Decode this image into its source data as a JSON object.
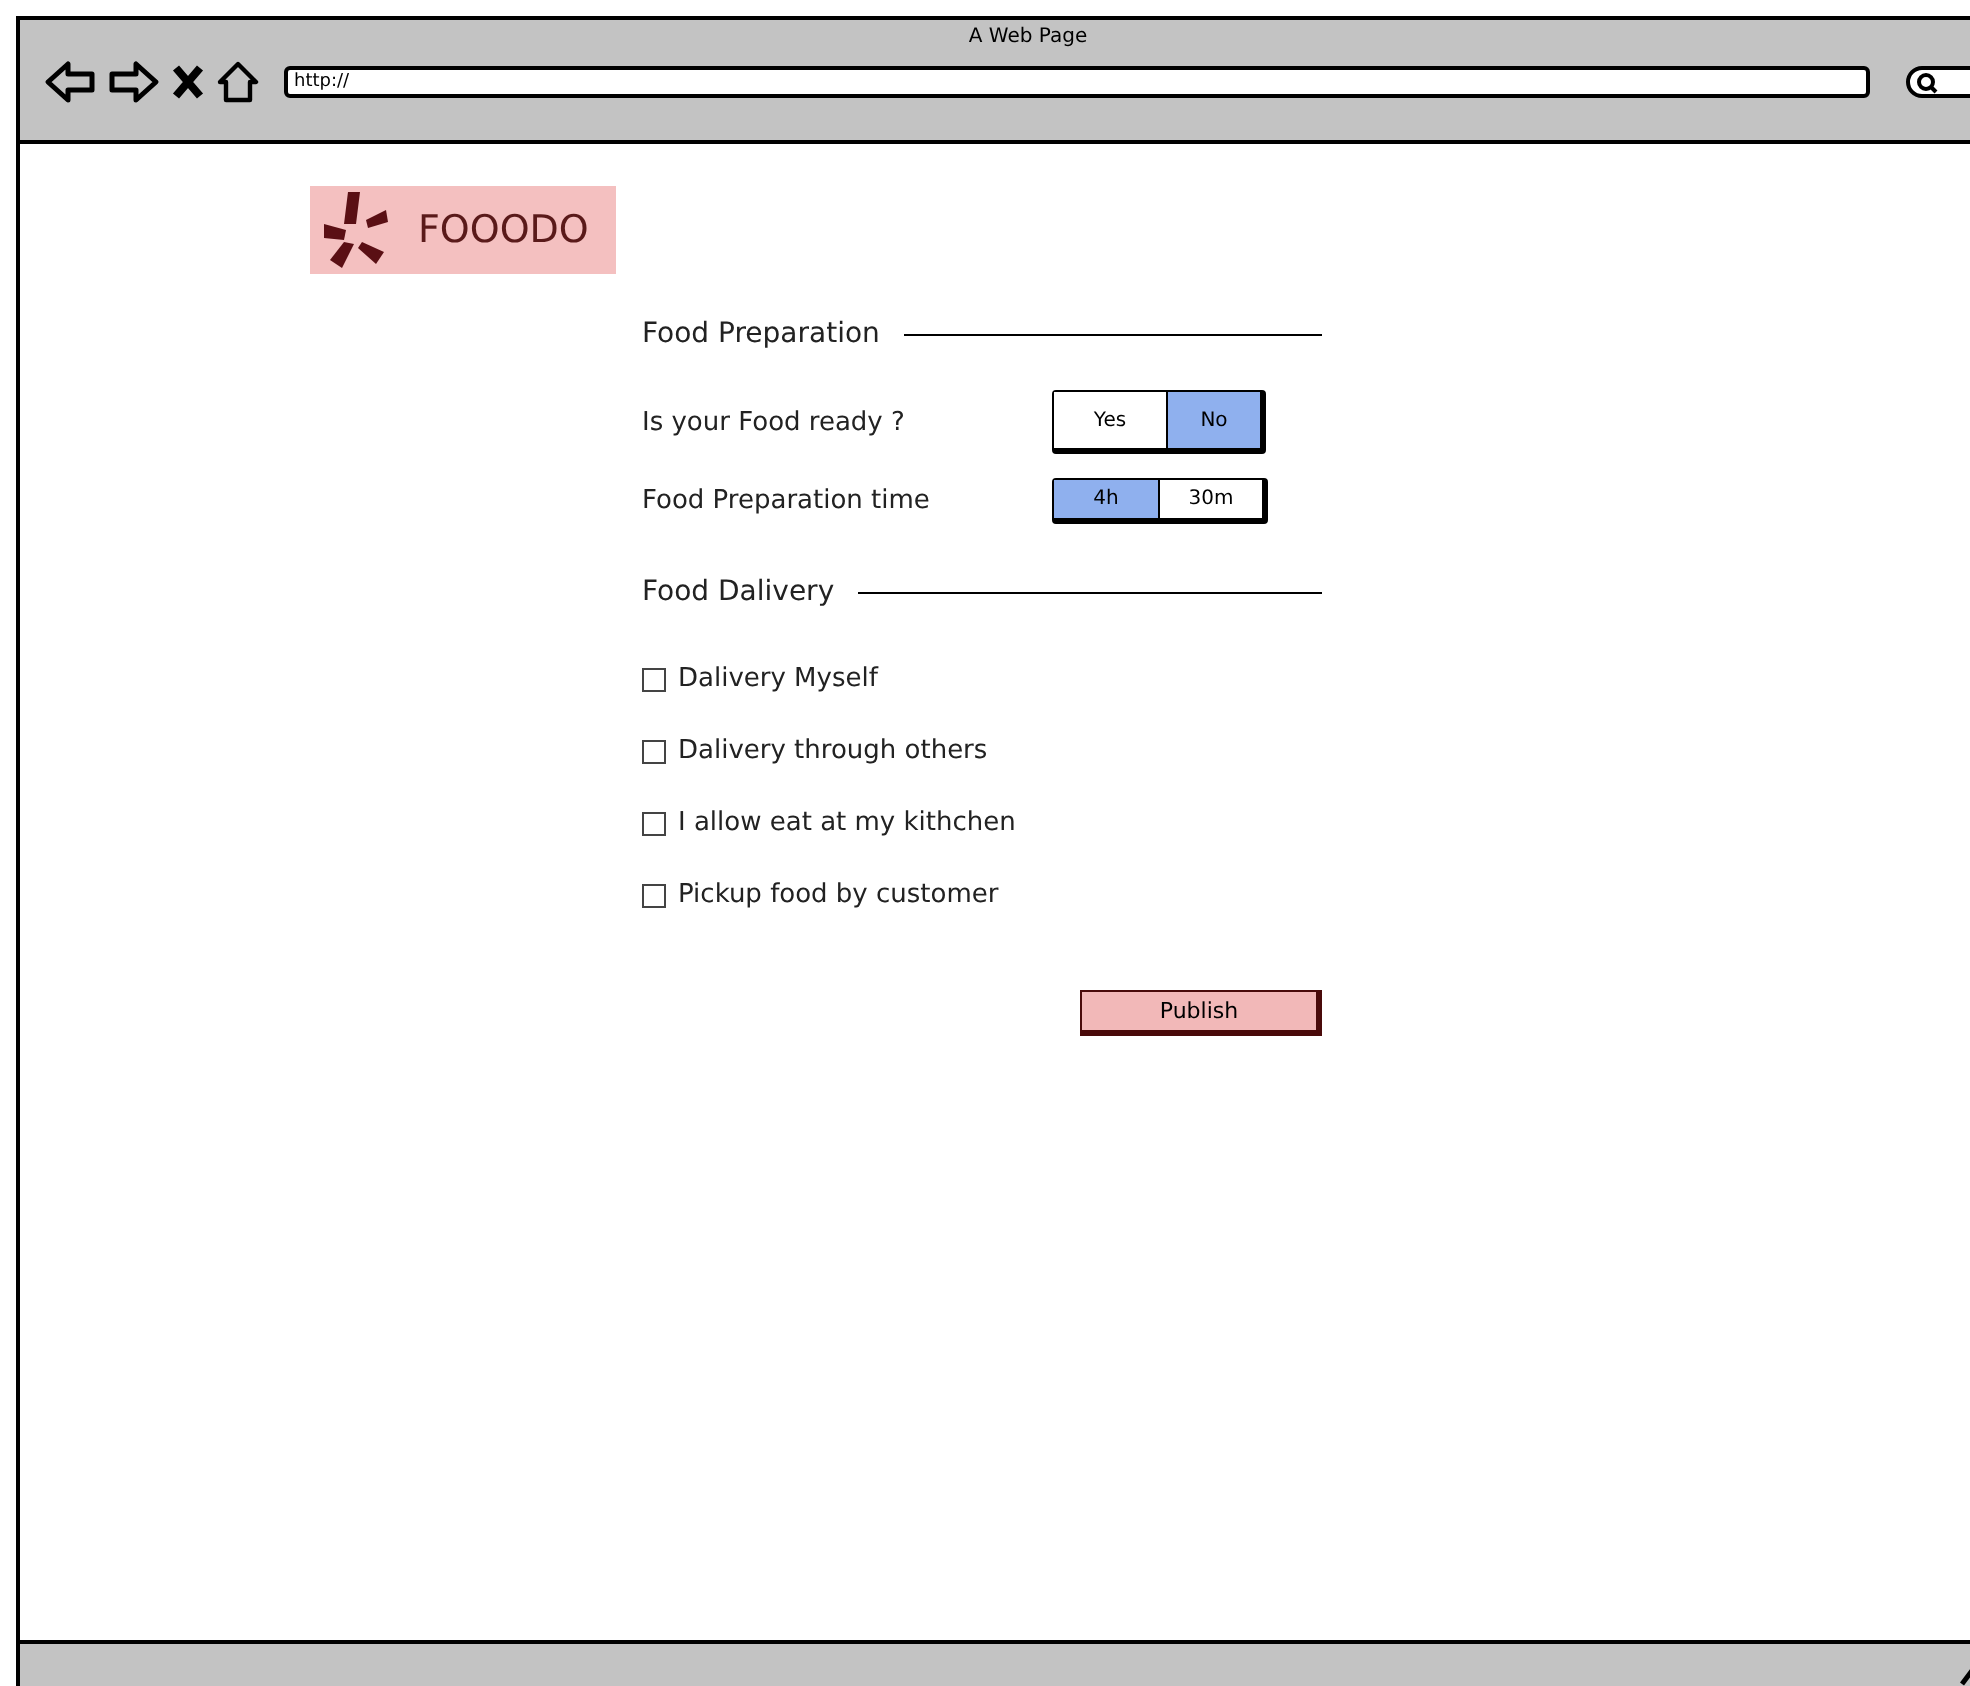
{
  "window": {
    "title": "A Web Page"
  },
  "address_bar": {
    "value": "http://"
  },
  "logo": {
    "text": "FOOODO"
  },
  "sections": [
    {
      "kind": "toggles",
      "title": "Food Preparation",
      "rows": [
        {
          "label": "Is your Food ready ?",
          "options": [
            {
              "label": "Yes",
              "selected": false
            },
            {
              "label": "No",
              "selected": true
            }
          ]
        },
        {
          "label": "Food Preparation time",
          "options": [
            {
              "label": "4h",
              "selected": true
            },
            {
              "label": "30m",
              "selected": false
            }
          ]
        }
      ]
    },
    {
      "kind": "checkboxes",
      "title": "Food Dalivery",
      "items": [
        {
          "label": "Dalivery Myself",
          "checked": false
        },
        {
          "label": "Dalivery through others",
          "checked": false
        },
        {
          "label": "I allow eat at my kithchen",
          "checked": false
        },
        {
          "label": "Pickup food by customer",
          "checked": false
        }
      ]
    }
  ],
  "publish_button": "Publish"
}
